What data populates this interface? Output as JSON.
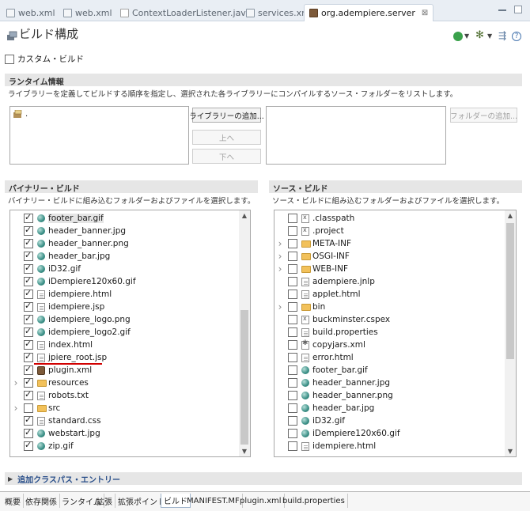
{
  "editor_tabs": [
    {
      "label": "web.xml",
      "icon": "xml-file-icon"
    },
    {
      "label": "web.xml",
      "icon": "xml-file-icon"
    },
    {
      "label": "ContextLoaderListener.java",
      "icon": "java-file-icon"
    },
    {
      "label": "services.xml",
      "icon": "xml-file-icon"
    },
    {
      "label": "org.adempiere.server",
      "icon": "plugin-manifest-icon",
      "active": true,
      "close": "⊠"
    }
  ],
  "page": {
    "title": "ビルド構成"
  },
  "custom_build": {
    "label": "カスタム・ビルド",
    "checked": false
  },
  "runtime": {
    "header": "ランタイム情報",
    "description": "ライブラリーを定義してビルドする順序を指定し、選択された各ライブラリーにコンパイルするソース・フォルダーをリストします。",
    "library_item": ".",
    "add_library": "ライブラリーの追加...",
    "up": "上へ",
    "down": "下へ",
    "add_folder": "フォルダーの追加..."
  },
  "binary_build": {
    "header": "バイナリー・ビルド",
    "description": "バイナリー・ビルドに組み込むフォルダーおよびファイルを選択します。",
    "items": [
      {
        "label": "footer_bar.gif",
        "icon": "image",
        "checked": true,
        "selected": true
      },
      {
        "label": "header_banner.jpg",
        "icon": "image",
        "checked": true
      },
      {
        "label": "header_banner.png",
        "icon": "image",
        "checked": true
      },
      {
        "label": "header_bar.jpg",
        "icon": "image",
        "checked": true
      },
      {
        "label": "iD32.gif",
        "icon": "image",
        "checked": true
      },
      {
        "label": "iDempiere120x60.gif",
        "icon": "image",
        "checked": true
      },
      {
        "label": "idempiere.html",
        "icon": "doc",
        "checked": true
      },
      {
        "label": "idempiere.jsp",
        "icon": "doc",
        "checked": true
      },
      {
        "label": "idempiere_logo.png",
        "icon": "image",
        "checked": true
      },
      {
        "label": "idempiere_logo2.gif",
        "icon": "image",
        "checked": true
      },
      {
        "label": "index.html",
        "icon": "doc",
        "checked": true
      },
      {
        "label": "jpiere_root.jsp",
        "icon": "doc",
        "checked": true,
        "underlined": true
      },
      {
        "label": "plugin.xml",
        "icon": "plugin",
        "checked": true
      },
      {
        "label": "resources",
        "icon": "folder",
        "checked": true,
        "expandable": true
      },
      {
        "label": "robots.txt",
        "icon": "doc",
        "checked": true
      },
      {
        "label": "src",
        "icon": "folder",
        "checked": false,
        "expandable": true
      },
      {
        "label": "standard.css",
        "icon": "doc",
        "checked": true
      },
      {
        "label": "webstart.jpg",
        "icon": "image",
        "checked": true
      },
      {
        "label": "zip.gif",
        "icon": "image",
        "checked": true
      }
    ]
  },
  "source_build": {
    "header": "ソース・ビルド",
    "description": "ソース・ビルドに組み込むフォルダーおよびファイルを選択します。",
    "items": [
      {
        "label": ".classpath",
        "icon": "xdoc",
        "checked": false
      },
      {
        "label": ".project",
        "icon": "xdoc",
        "checked": false
      },
      {
        "label": "META-INF",
        "icon": "folder",
        "checked": false,
        "expandable": true
      },
      {
        "label": "OSGI-INF",
        "icon": "folder",
        "checked": false,
        "expandable": true
      },
      {
        "label": "WEB-INF",
        "icon": "folder",
        "checked": false,
        "expandable": true
      },
      {
        "label": "adempiere.jnlp",
        "icon": "doc",
        "checked": false
      },
      {
        "label": "applet.html",
        "icon": "doc",
        "checked": false
      },
      {
        "label": "bin",
        "icon": "folder",
        "checked": false,
        "expandable": true
      },
      {
        "label": "buckminster.cspex",
        "icon": "xdoc",
        "checked": false
      },
      {
        "label": "build.properties",
        "icon": "doc",
        "checked": false
      },
      {
        "label": "copyjars.xml",
        "icon": "gear",
        "checked": false
      },
      {
        "label": "error.html",
        "icon": "doc",
        "checked": false
      },
      {
        "label": "footer_bar.gif",
        "icon": "image",
        "checked": false
      },
      {
        "label": "header_banner.jpg",
        "icon": "image",
        "checked": false
      },
      {
        "label": "header_banner.png",
        "icon": "image",
        "checked": false
      },
      {
        "label": "header_bar.jpg",
        "icon": "image",
        "checked": false
      },
      {
        "label": "iD32.gif",
        "icon": "image",
        "checked": false
      },
      {
        "label": "iDempiere120x60.gif",
        "icon": "image",
        "checked": false
      },
      {
        "label": "idempiere.html",
        "icon": "doc",
        "checked": false
      }
    ]
  },
  "extra_classpath": {
    "label": "追加クラスパス・エントリー"
  },
  "bottom_tabs": [
    {
      "label": "概要"
    },
    {
      "label": "依存関係"
    },
    {
      "label": "ランタイム"
    },
    {
      "label": "拡張"
    },
    {
      "label": "拡張ポイント"
    },
    {
      "label": "ビルド",
      "active": true
    },
    {
      "label": "MANIFEST.MF"
    },
    {
      "label": "plugin.xml"
    },
    {
      "label": "build.properties"
    }
  ],
  "colors": {
    "tabbar_bg": "#e9eef4",
    "section_bg": "#e6e6e6",
    "underline": "#d10000",
    "image_icon": "#3a8f86",
    "folder_icon": "#f2c15a"
  }
}
